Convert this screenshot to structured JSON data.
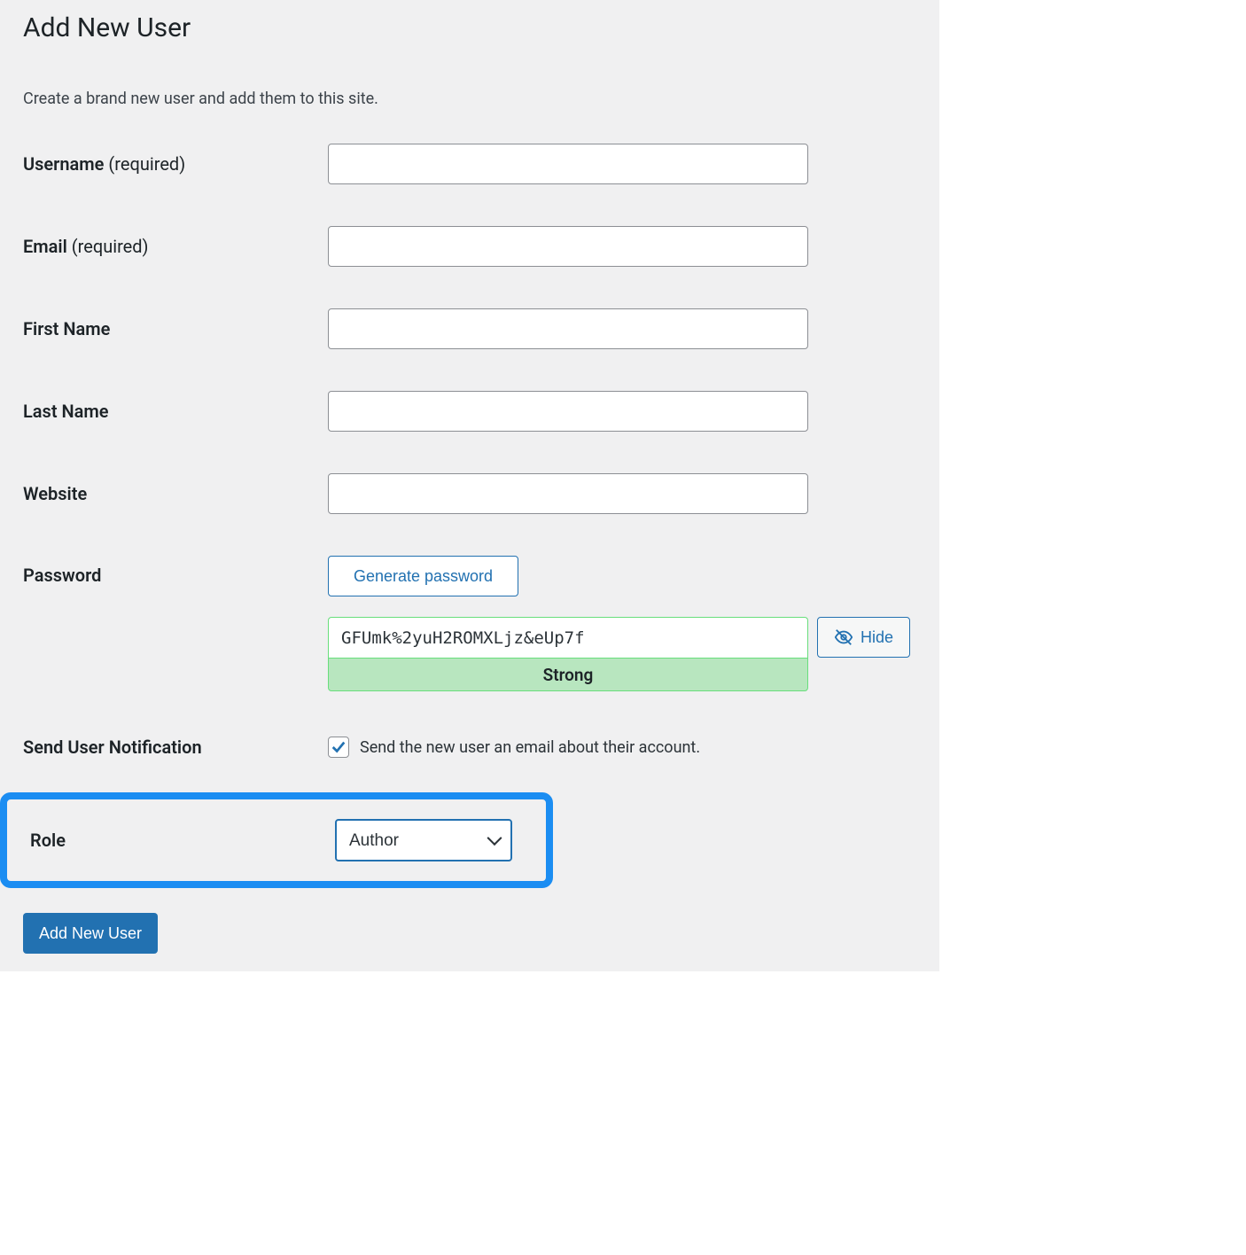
{
  "page": {
    "title": "Add New User",
    "description": "Create a brand new user and add them to this site."
  },
  "fields": {
    "username": {
      "label": "Username",
      "required_text": "(required)",
      "value": ""
    },
    "email": {
      "label": "Email",
      "required_text": "(required)",
      "value": ""
    },
    "first_name": {
      "label": "First Name",
      "value": ""
    },
    "last_name": {
      "label": "Last Name",
      "value": ""
    },
    "website": {
      "label": "Website",
      "value": ""
    },
    "password": {
      "label": "Password",
      "generate_button": "Generate password",
      "value": "GFUmk%2yuH2ROMXLjz&eUp7f",
      "strength": "Strong",
      "hide_button": "Hide"
    },
    "notification": {
      "label": "Send User Notification",
      "checkbox_checked": true,
      "checkbox_text": "Send the new user an email about their account."
    },
    "role": {
      "label": "Role",
      "selected": "Author"
    }
  },
  "actions": {
    "submit": "Add New User"
  },
  "colors": {
    "primary": "#2271b1",
    "highlight_border": "#1b8df2",
    "strength_bg": "#b8e6bf",
    "strength_border": "#68de7c"
  }
}
